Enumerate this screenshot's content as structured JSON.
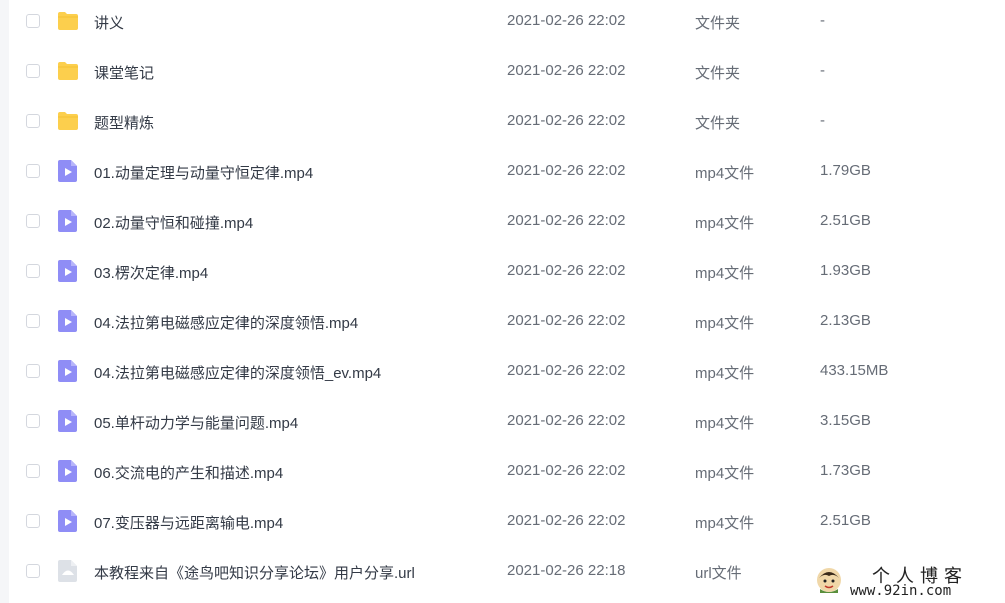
{
  "files": [
    {
      "name": "讲义",
      "date": "2021-02-26 22:02",
      "type": "文件夹",
      "size": "-",
      "icon": "folder-icon"
    },
    {
      "name": "课堂笔记",
      "date": "2021-02-26 22:02",
      "type": "文件夹",
      "size": "-",
      "icon": "folder-icon"
    },
    {
      "name": "题型精炼",
      "date": "2021-02-26 22:02",
      "type": "文件夹",
      "size": "-",
      "icon": "folder-icon"
    },
    {
      "name": "01.动量定理与动量守恒定律.mp4",
      "date": "2021-02-26 22:02",
      "type": "mp4文件",
      "size": "1.79GB",
      "icon": "video-file-icon"
    },
    {
      "name": "02.动量守恒和碰撞.mp4",
      "date": "2021-02-26 22:02",
      "type": "mp4文件",
      "size": "2.51GB",
      "icon": "video-file-icon"
    },
    {
      "name": "03.楞次定律.mp4",
      "date": "2021-02-26 22:02",
      "type": "mp4文件",
      "size": "1.93GB",
      "icon": "video-file-icon"
    },
    {
      "name": "04.法拉第电磁感应定律的深度领悟.mp4",
      "date": "2021-02-26 22:02",
      "type": "mp4文件",
      "size": "2.13GB",
      "icon": "video-file-icon"
    },
    {
      "name": "04.法拉第电磁感应定律的深度领悟_ev.mp4",
      "date": "2021-02-26 22:02",
      "type": "mp4文件",
      "size": "433.15MB",
      "icon": "video-file-icon"
    },
    {
      "name": "05.单杆动力学与能量问题.mp4",
      "date": "2021-02-26 22:02",
      "type": "mp4文件",
      "size": "3.15GB",
      "icon": "video-file-icon"
    },
    {
      "name": "06.交流电的产生和描述.mp4",
      "date": "2021-02-26 22:02",
      "type": "mp4文件",
      "size": "1.73GB",
      "icon": "video-file-icon"
    },
    {
      "name": "07.变压器与远距离输电.mp4",
      "date": "2021-02-26 22:02",
      "type": "mp4文件",
      "size": "2.51GB",
      "icon": "video-file-icon"
    },
    {
      "name": "本教程来自《途鸟吧知识分享论坛》用户分享.url",
      "date": "2021-02-26 22:18",
      "type": "url文件",
      "size": "",
      "icon": "link-file-icon"
    }
  ],
  "watermark": {
    "title": "个人博客",
    "url": "www.92in.com"
  },
  "colors": {
    "folder": "#fccf4d",
    "video": "#8f8df6",
    "url": "#dde1e7",
    "checkbox_border": "#d4d7de"
  }
}
